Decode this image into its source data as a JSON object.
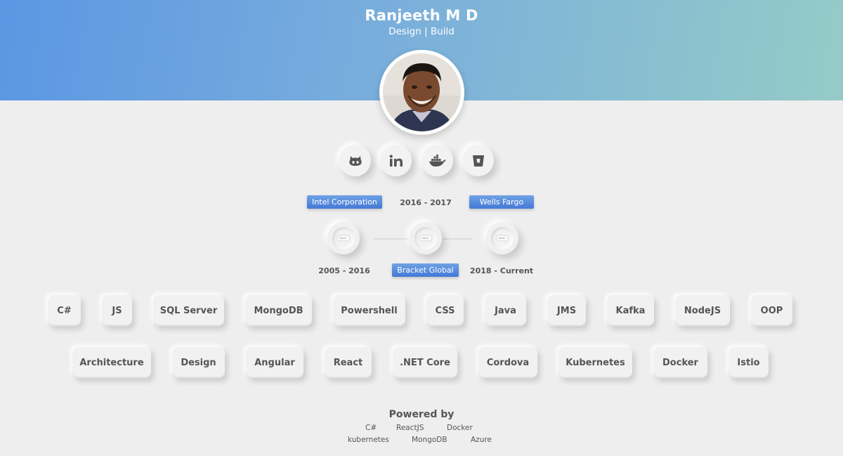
{
  "profile": {
    "name": "Ranjeeth M D",
    "tagline": "Design | Build"
  },
  "socials": [
    {
      "name": "github",
      "icon": "github-icon"
    },
    {
      "name": "linkedin",
      "icon": "linkedin-icon"
    },
    {
      "name": "docker",
      "icon": "docker-icon"
    },
    {
      "name": "bitbucket",
      "icon": "bitbucket-icon"
    }
  ],
  "timeline": {
    "top_labels": {
      "intel": "Intel Corporation",
      "bracket_years": "2016 - 2017",
      "wells": "Wells Fargo"
    },
    "bottom_labels": {
      "intel_years": "2005 - 2016",
      "bracket": "Bracket Global",
      "wells_years": "2018 - Current"
    }
  },
  "skills": {
    "row1": [
      "C#",
      "JS",
      "SQL Server",
      "MongoDB",
      "Powershell",
      "CSS",
      "Java",
      "JMS",
      "Kafka",
      "NodeJS",
      "OOP"
    ],
    "row2": [
      "Architecture",
      "Design",
      "Angular",
      "React",
      ".NET Core",
      "Cordova",
      "Kubernetes",
      "Docker",
      "Istio"
    ]
  },
  "footer": {
    "title": "Powered by",
    "line1": [
      "C#",
      "ReactJS",
      "Docker"
    ],
    "line2": [
      "kubernetes",
      "MongoDB",
      "Azure"
    ]
  },
  "colors": {
    "header_gradient_start": "#5b96e3",
    "header_gradient_end": "#95cbc7",
    "tag_blue": "#4479d6",
    "background": "#eeeeee"
  }
}
